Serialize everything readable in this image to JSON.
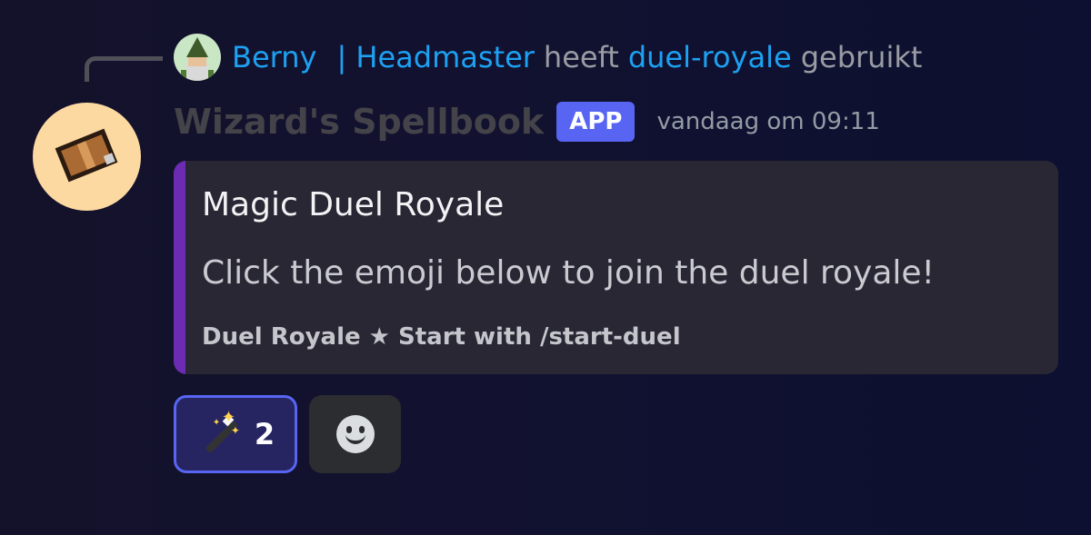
{
  "reply": {
    "user": "Berny",
    "role": "| Headmaster",
    "verb": "heeft",
    "command": "duel-royale",
    "suffix": "gebruikt"
  },
  "message": {
    "author": "Wizard's Spellbook",
    "tag": "APP",
    "timestamp": "vandaag om 09:11"
  },
  "embed": {
    "accent_color": "#6b2bb3",
    "title": "Magic Duel Royale",
    "description": "Click the emoji below to join the duel royale!",
    "footer": "Duel Royale ★ Start with /start-duel"
  },
  "reactions": [
    {
      "emoji": "magic-wand-icon",
      "count": "2",
      "selected": true
    }
  ],
  "add_reaction_icon": "smiley-add-reaction-icon",
  "colors": {
    "mention": "#1da1f2",
    "app_tag": "#5865f2",
    "background": "#14122a"
  }
}
